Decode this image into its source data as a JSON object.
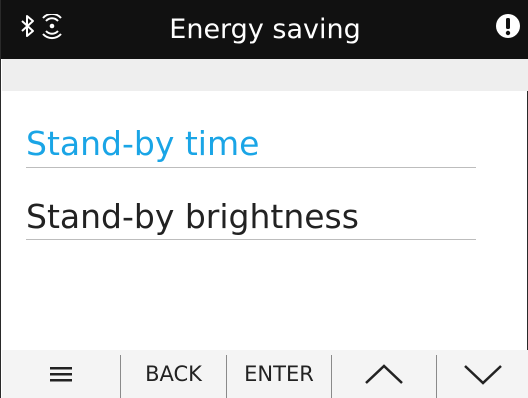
{
  "header": {
    "title": "Energy saving",
    "icons": [
      "bluetooth-icon",
      "wireless-signal-icon",
      "alert-icon"
    ]
  },
  "menu": {
    "items": [
      {
        "label": "Stand-by time",
        "selected": true
      },
      {
        "label": "Stand-by brightness",
        "selected": false
      }
    ]
  },
  "footer": {
    "menu_icon": "menu-icon",
    "back_label": "BACK",
    "enter_label": "ENTER",
    "up_icon": "chevron-up-icon",
    "down_icon": "chevron-down-icon"
  },
  "colors": {
    "header_bg": "#111111",
    "selected": "#1aa5e6",
    "text": "#222222"
  }
}
